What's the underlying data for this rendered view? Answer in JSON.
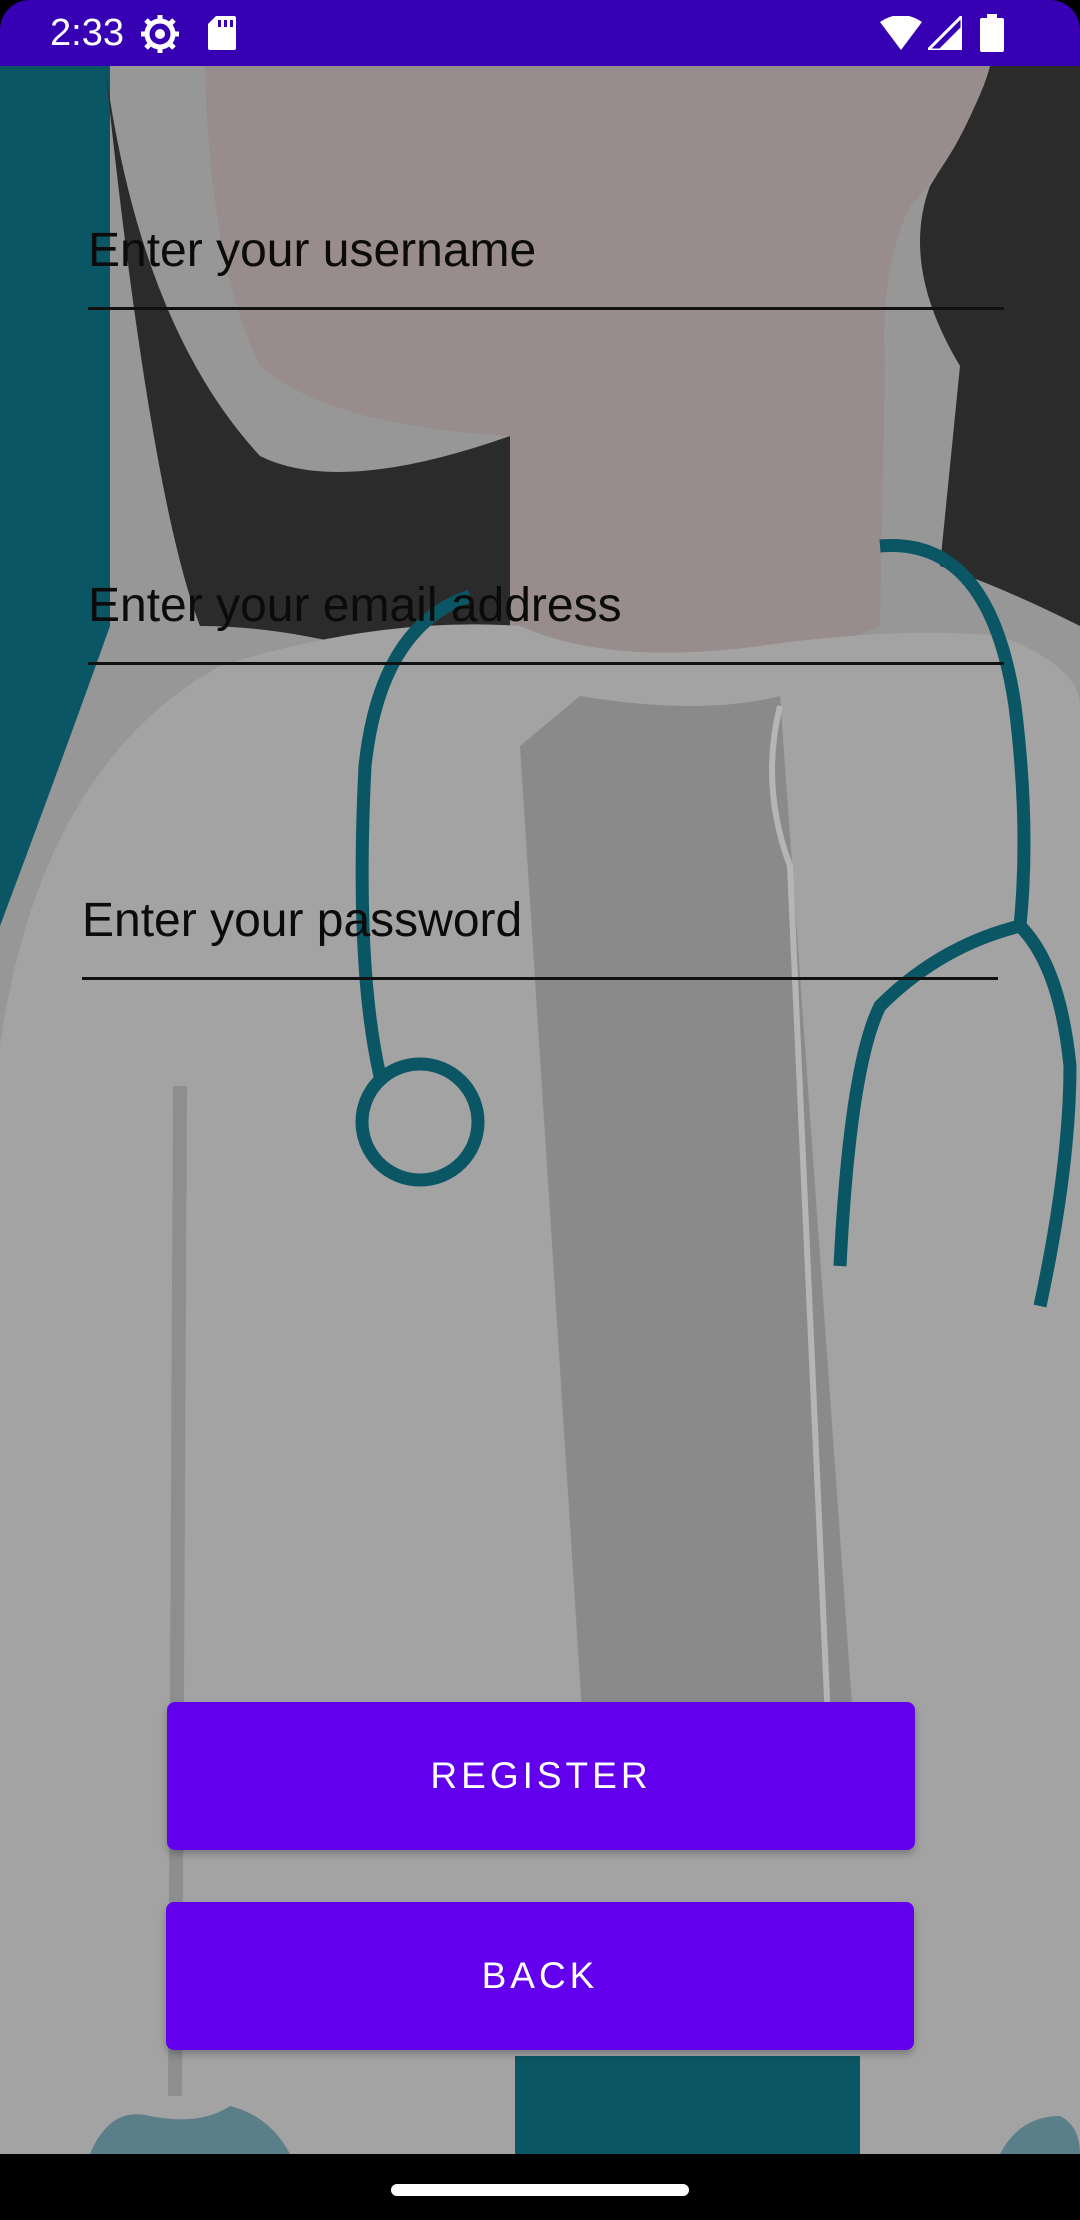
{
  "status_bar": {
    "time": "2:33",
    "background": "#3700b3",
    "icons": [
      "settings-gear-icon",
      "sd-card-icon",
      "wifi-icon",
      "cell-signal-icon",
      "battery-icon"
    ]
  },
  "form": {
    "username": {
      "placeholder": "Enter your username",
      "value": ""
    },
    "email": {
      "placeholder": "Enter your email address",
      "value": ""
    },
    "password": {
      "placeholder": "Enter your password",
      "value": ""
    }
  },
  "buttons": {
    "register_label": "REGISTER",
    "back_label": "BACK",
    "color": "#6200ee"
  },
  "background": {
    "illustration": "doctor-with-stethoscope"
  }
}
